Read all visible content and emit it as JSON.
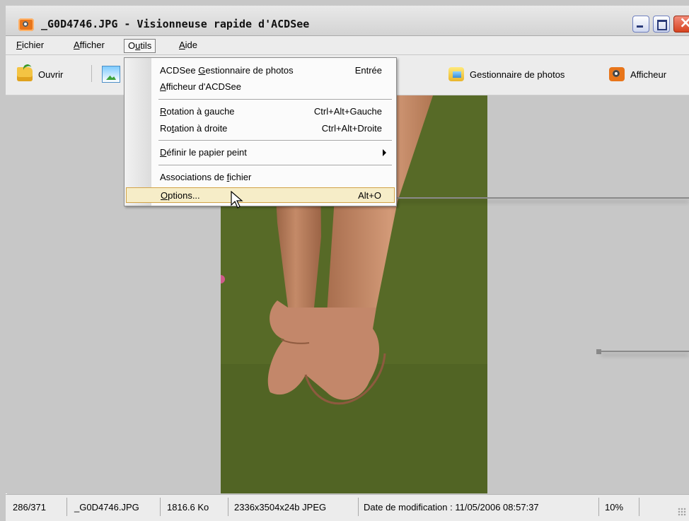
{
  "window": {
    "title": "_G0D4746.JPG - Visionneuse rapide d'ACDSee",
    "app_icon": "acdsee-camera-icon"
  },
  "menubar": {
    "items": [
      {
        "label": "Fichier",
        "accel": "F",
        "rest": "ichier"
      },
      {
        "label": "Afficher",
        "accel": "A",
        "rest": "fficher"
      },
      {
        "label": "Outils",
        "pre": "O",
        "accel": "u",
        "rest": "tils"
      },
      {
        "label": "Aide",
        "accel": "A",
        "rest": "ide"
      }
    ]
  },
  "toolbar": {
    "open_label": "Ouvrir",
    "open_icon": "folder-open-icon",
    "image_icon": "image-edit-icon",
    "browser_label": "Gestionnaire de photos",
    "browser_icon": "photo-manager-icon",
    "viewer_label": "Afficheur",
    "viewer_icon": "viewer-icon"
  },
  "dropdown": {
    "items": [
      {
        "label_pre": "ACDSee ",
        "accel": "G",
        "label_post": "estionnaire de photos",
        "shortcut": "Entrée"
      },
      {
        "label_pre": "",
        "accel": "A",
        "label_post": "fficheur d'ACDSee",
        "shortcut": ""
      },
      {
        "label_pre": "",
        "accel": "R",
        "label_post": "otation à gauche",
        "shortcut": "Ctrl+Alt+Gauche"
      },
      {
        "label_pre": "Ro",
        "accel": "t",
        "label_post": "ation à  droite",
        "shortcut": "Ctrl+Alt+Droite"
      },
      {
        "label_pre": "",
        "accel": "D",
        "label_post": "éfinir le papier peint",
        "shortcut": ""
      },
      {
        "label_pre": "Associations de ",
        "accel": "f",
        "label_post": "ichier",
        "shortcut": ""
      },
      {
        "label_pre": "",
        "accel": "O",
        "label_post": "ptions...",
        "shortcut": "Alt+O"
      }
    ],
    "highlighted": "Options..."
  },
  "statusbar": {
    "position": "286/371",
    "filename": "_G0D4746.JPG",
    "filesize": "1816.6 Ko",
    "dimensions": "2336x3504x24b JPEG",
    "modified": "Date de modification : 11/05/2006 08:57:37",
    "zoom": "10%"
  },
  "colors": {
    "menu_highlight_bg": "#f6edc8",
    "menu_highlight_border": "#d2a348",
    "viewport_bg": "#c7c7c7"
  }
}
